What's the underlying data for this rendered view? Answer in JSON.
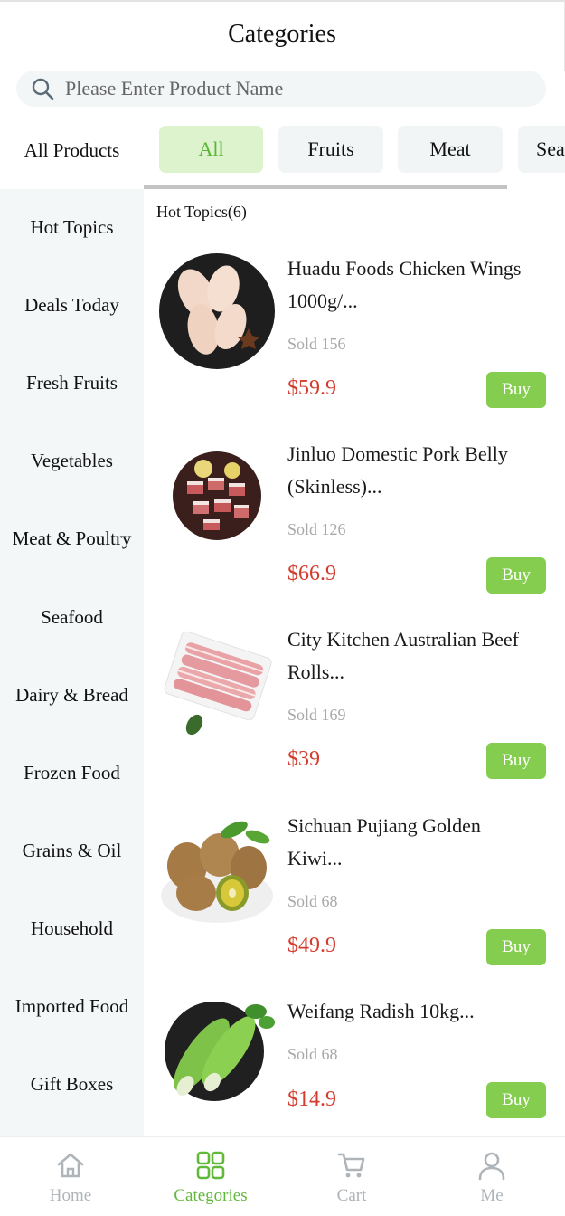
{
  "header": {
    "title": "Categories"
  },
  "search": {
    "placeholder": "Please Enter Product Name"
  },
  "category_tabs": {
    "all_products_label": "All Products",
    "chips": [
      "All",
      "Fruits",
      "Meat",
      "Sea"
    ],
    "active_index": 0
  },
  "sidebar": {
    "items": [
      "Hot Topics",
      "Deals Today",
      "Fresh Fruits",
      "Vegetables",
      "Meat & Poultry",
      "Seafood",
      "Dairy & Bread",
      "Frozen Food",
      "Grains & Oil",
      "Household",
      "Imported Food",
      "Gift Boxes"
    ]
  },
  "section": {
    "title": "Hot Topics(6)"
  },
  "products": [
    {
      "name_line1": "Huadu Foods Chicken Wings",
      "name_line2": "1000g/...",
      "sold": "Sold 156",
      "price": "$59.9",
      "buy_label": "Buy",
      "image": "chicken-wings"
    },
    {
      "name_line1": "Jinluo Domestic Pork Belly",
      "name_line2": "(Skinless)...",
      "sold": "Sold 126",
      "price": "$66.9",
      "buy_label": "Buy",
      "image": "pork-belly"
    },
    {
      "name_line1": "City Kitchen Australian Beef",
      "name_line2": "Rolls...",
      "sold": "Sold 169",
      "price": "$39",
      "buy_label": "Buy",
      "image": "beef-rolls"
    },
    {
      "name_line1": "Sichuan Pujiang Golden",
      "name_line2": "Kiwi...",
      "sold": "Sold 68",
      "price": "$49.9",
      "buy_label": "Buy",
      "image": "kiwi"
    },
    {
      "name_line1": "Weifang Radish 10kg...",
      "name_line2": "",
      "sold": "Sold 68",
      "price": "$14.9",
      "buy_label": "Buy",
      "image": "radish"
    }
  ],
  "tabbar": {
    "items": [
      {
        "label": "Home",
        "icon": "home-icon"
      },
      {
        "label": "Categories",
        "icon": "categories-icon"
      },
      {
        "label": "Cart",
        "icon": "cart-icon"
      },
      {
        "label": "Me",
        "icon": "user-icon"
      }
    ],
    "active_index": 1
  },
  "colors": {
    "accent": "#84cd4f",
    "active_chip_bg": "#dcf3cd",
    "price": "#d43c2e",
    "sidebar_bg": "#f4f7f8"
  }
}
